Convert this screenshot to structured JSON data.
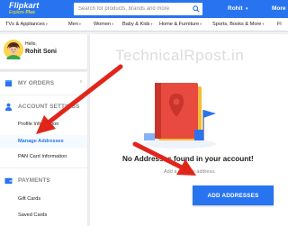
{
  "header": {
    "logo_name": "Flipkart",
    "logo_tagline": "Explore",
    "logo_tagline_plus": "Plus",
    "search_placeholder": "Search for products, brands and more",
    "user_label": "Rohit",
    "more_label": "More",
    "brand_color": "#2874f0",
    "tagline_color": "#ffe11b"
  },
  "nav": {
    "items": [
      "TVs & Appliances",
      "Men",
      "Women",
      "Baby & Kids",
      "Home & Furniture",
      "Sports, Books & More",
      "Fl"
    ]
  },
  "profile": {
    "greeting": "Hello,",
    "name": "Rohit Soni"
  },
  "sidebar": {
    "my_orders": "MY ORDERS",
    "account_settings": "ACCOUNT SETTINGS",
    "profile_information": "Profile Information",
    "manage_addresses": "Manage Addresses",
    "pan_card": "PAN Card Information",
    "payments": "PAYMENTS",
    "gift_cards": "Gift Cards",
    "saved_cards": "Saved Cards"
  },
  "main": {
    "watermark": "TechnicalRpost.in",
    "empty_title": "No Addresses found in your account!",
    "empty_subtitle": "Add a delivery address.",
    "add_button": "ADD ADDRESSES"
  },
  "icons": {
    "search": "search-icon",
    "orders": "box-icon",
    "account": "person-icon",
    "payments": "wallet-icon",
    "avatar": "avatar-icon"
  },
  "annotation_color": "#e1251b"
}
